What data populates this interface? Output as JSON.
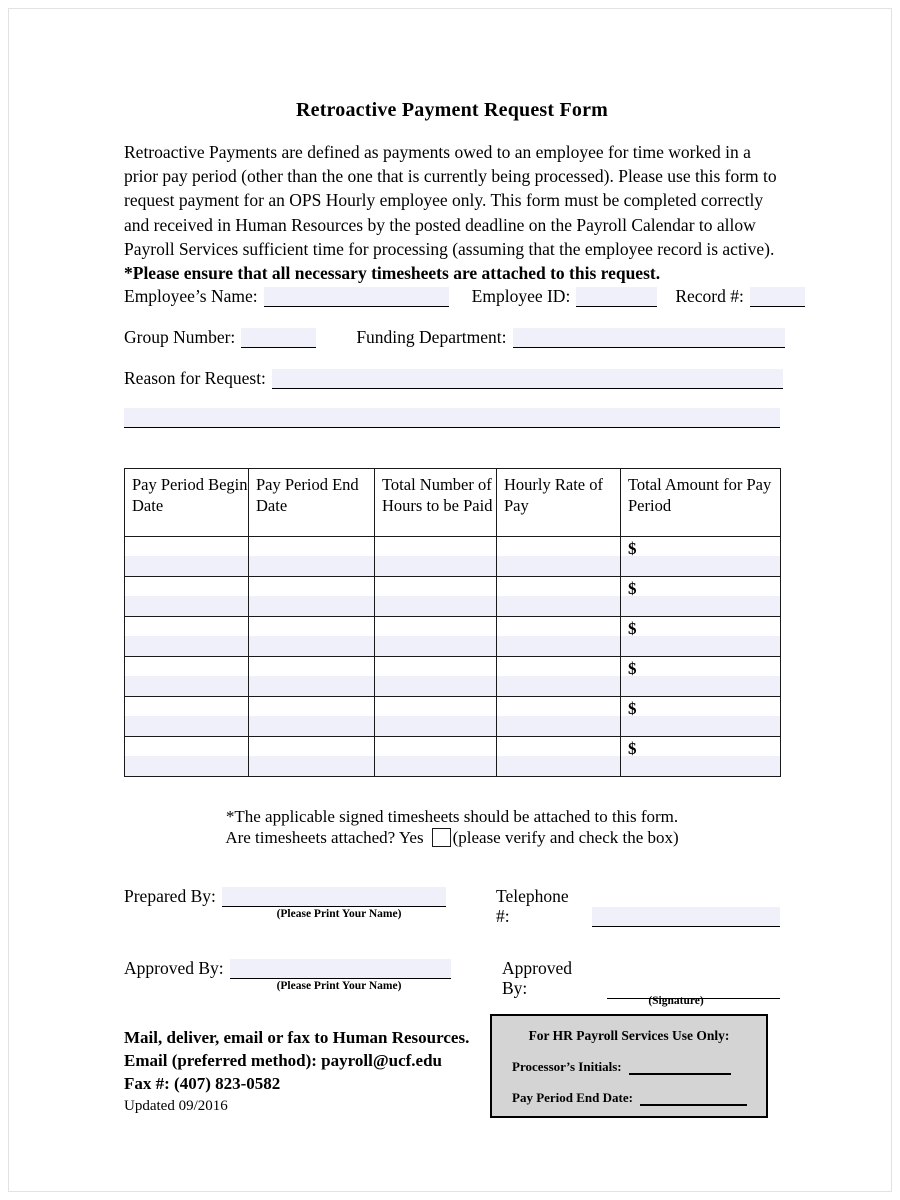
{
  "document": {
    "title": "Retroactive Payment Request Form",
    "intro_paragraph": "Retroactive Payments are defined as payments owed to an employee for time worked in a prior pay period (other than the one that is currently being processed).  Please use this form to request payment for an OPS Hourly employee only.  This form must be completed correctly and received in Human Resources by the posted deadline on the Payroll Calendar to allow Payroll Services sufficient time for processing (assuming that the employee record is active).",
    "intro_bold_note": "*Please ensure that all necessary timesheets are attached to this request."
  },
  "fields": {
    "employee_name_label": "Employee’s Name:",
    "employee_name_value": "",
    "employee_id_label": "Employee ID:",
    "employee_id_value": "",
    "record_number_label": "Record #:",
    "record_number_value": "",
    "group_number_label": "Group Number:",
    "group_number_value": "",
    "funding_department_label": "Funding Department:",
    "funding_department_value": "",
    "reason_label": "Reason for Request:",
    "reason_value": "",
    "reason_line2_value": ""
  },
  "pay_table": {
    "headers": [
      "Pay Period Begin Date",
      "Pay Period End Date",
      "Total Number of Hours to be Paid",
      "Hourly Rate of Pay",
      "Total Amount for Pay Period"
    ],
    "currency_symbol": "$",
    "rows": [
      {
        "begin_date": "",
        "end_date": "",
        "hours": "",
        "rate": "",
        "amount": ""
      },
      {
        "begin_date": "",
        "end_date": "",
        "hours": "",
        "rate": "",
        "amount": ""
      },
      {
        "begin_date": "",
        "end_date": "",
        "hours": "",
        "rate": "",
        "amount": ""
      },
      {
        "begin_date": "",
        "end_date": "",
        "hours": "",
        "rate": "",
        "amount": ""
      },
      {
        "begin_date": "",
        "end_date": "",
        "hours": "",
        "rate": "",
        "amount": ""
      },
      {
        "begin_date": "",
        "end_date": "",
        "hours": "",
        "rate": "",
        "amount": ""
      }
    ]
  },
  "timesheet_note": {
    "line1": "*The applicable signed timesheets should be attached to this form.",
    "question": "Are timesheets attached?  Yes",
    "hint": "(please verify and check the box)",
    "checked": false
  },
  "signatures": {
    "prepared_by_label": "Prepared By:",
    "prepared_by_value": "",
    "prepared_by_caption": "(Please Print Your Name)",
    "telephone_label": "Telephone #:",
    "telephone_value": "",
    "approved_by_print_label": "Approved By:",
    "approved_by_print_value": "",
    "approved_by_print_caption": "(Please Print Your Name)",
    "approved_by_sign_label": "Approved By:",
    "approved_by_sign_value": "",
    "approved_by_sign_caption": "(Signature)"
  },
  "footer": {
    "line1": "Mail, deliver, email or fax to Human Resources.",
    "line2": "Email (preferred method): payroll@ucf.edu",
    "line3": "Fax #: (407) 823-0582",
    "updated": "Updated 09/2016"
  },
  "hr_box": {
    "title": "For HR Payroll Services Use Only:",
    "processor_initials_label": "Processor’s Initials:",
    "processor_initials_value": "",
    "pay_period_end_label": "Pay Period End Date:",
    "pay_period_end_value": ""
  },
  "colors": {
    "field_fill": "#f0f0fa",
    "hr_box_fill": "#d4d4d4",
    "border": "#1a1a1a",
    "page_border": "#e2e2e2"
  }
}
